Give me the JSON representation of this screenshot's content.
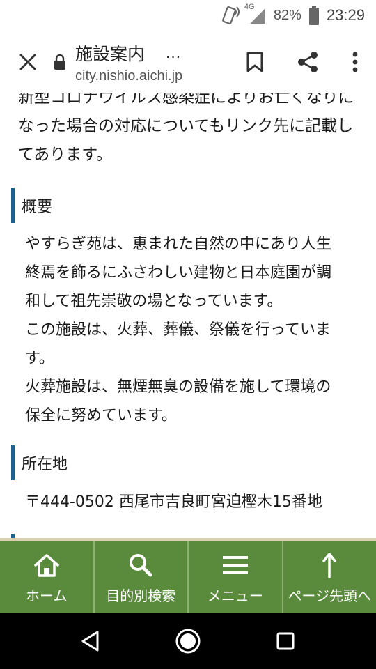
{
  "status_bar": {
    "network": "4G",
    "battery_percent": "82%",
    "time": "23:29"
  },
  "toolbar": {
    "page_title": "施設案内",
    "ellipsis": "...",
    "url": "city.nishio.aichi.jp"
  },
  "content": {
    "intro_lines": [
      "新型コロナウイルス感染症によりお亡くなりに",
      "なった場合の対応についてもリンク先に記載し",
      "てあります。"
    ],
    "sections": [
      {
        "heading": "概要",
        "lines": [
          "やすらぎ苑は、恵まれた自然の中にあり人生",
          "終焉を飾るにふさわしい建物と日本庭園が調",
          "和して祖先崇敬の場となっています。",
          "この施設は、火葬、葬儀、祭儀を行っていま",
          "す。",
          "火葬施設は、無煙無臭の設備を施して環境の",
          "保全に努めています。"
        ]
      },
      {
        "heading": "所在地",
        "lines": [
          "〒444-0502 西尾市吉良町宮迫樫木15番地"
        ]
      }
    ]
  },
  "bottom_nav": {
    "items": [
      {
        "label": "ホーム",
        "icon": "home-icon"
      },
      {
        "label": "目的別検索",
        "icon": "search-icon"
      },
      {
        "label": "メニュー",
        "icon": "menu-icon"
      },
      {
        "label": "ページ先頭へ",
        "icon": "arrow-up-icon"
      }
    ]
  },
  "colors": {
    "nav_green": "#5a8a3c",
    "heading_bar": "#1f5f8b"
  }
}
